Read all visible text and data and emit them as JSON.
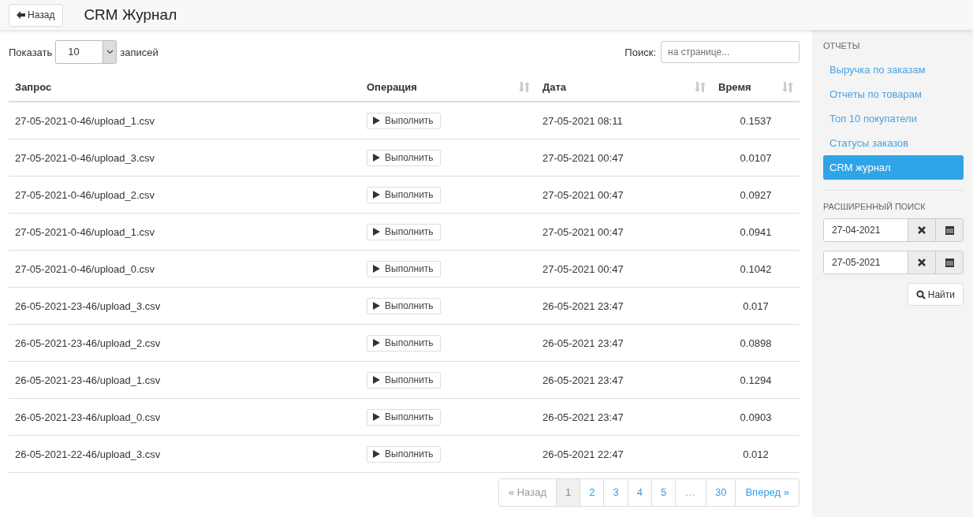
{
  "header": {
    "back_button": "Назад",
    "title": "CRM Журнал"
  },
  "length_control": {
    "before": "Показать",
    "value": "10",
    "after": "записей"
  },
  "search": {
    "label": "Поиск:",
    "placeholder": "на странице..."
  },
  "table": {
    "columns": [
      {
        "label": "Запрос",
        "sortable": false
      },
      {
        "label": "Операция",
        "sortable": true
      },
      {
        "label": "Дата",
        "sortable": true
      },
      {
        "label": "Время",
        "sortable": true
      }
    ],
    "rows": [
      {
        "request": "27-05-2021-0-46/upload_1.csv",
        "action": "Выполнить",
        "date": "27-05-2021 08:11",
        "time": "0.1537"
      },
      {
        "request": "27-05-2021-0-46/upload_3.csv",
        "action": "Выполнить",
        "date": "27-05-2021 00:47",
        "time": "0.0107"
      },
      {
        "request": "27-05-2021-0-46/upload_2.csv",
        "action": "Выполнить",
        "date": "27-05-2021 00:47",
        "time": "0.0927"
      },
      {
        "request": "27-05-2021-0-46/upload_1.csv",
        "action": "Выполнить",
        "date": "27-05-2021 00:47",
        "time": "0.0941"
      },
      {
        "request": "27-05-2021-0-46/upload_0.csv",
        "action": "Выполнить",
        "date": "27-05-2021 00:47",
        "time": "0.1042"
      },
      {
        "request": "26-05-2021-23-46/upload_3.csv",
        "action": "Выполнить",
        "date": "26-05-2021 23:47",
        "time": "0.017"
      },
      {
        "request": "26-05-2021-23-46/upload_2.csv",
        "action": "Выполнить",
        "date": "26-05-2021 23:47",
        "time": "0.0898"
      },
      {
        "request": "26-05-2021-23-46/upload_1.csv",
        "action": "Выполнить",
        "date": "26-05-2021 23:47",
        "time": "0.1294"
      },
      {
        "request": "26-05-2021-23-46/upload_0.csv",
        "action": "Выполнить",
        "date": "26-05-2021 23:47",
        "time": "0.0903"
      },
      {
        "request": "26-05-2021-22-46/upload_3.csv",
        "action": "Выполнить",
        "date": "26-05-2021 22:47",
        "time": "0.012"
      }
    ]
  },
  "pagination": [
    {
      "label": "« Назад",
      "kind": "prev",
      "disabled": true,
      "selected": false
    },
    {
      "label": "1",
      "kind": "page",
      "disabled": false,
      "selected": true
    },
    {
      "label": "2",
      "kind": "page",
      "disabled": false,
      "selected": false
    },
    {
      "label": "3",
      "kind": "page",
      "disabled": false,
      "selected": false
    },
    {
      "label": "4",
      "kind": "page",
      "disabled": false,
      "selected": false
    },
    {
      "label": "5",
      "kind": "page",
      "disabled": false,
      "selected": false
    },
    {
      "label": "...",
      "kind": "ellipsis",
      "disabled": true,
      "selected": false
    },
    {
      "label": "30",
      "kind": "page",
      "disabled": false,
      "selected": false
    },
    {
      "label": "Вперед »",
      "kind": "next",
      "disabled": false,
      "selected": false
    }
  ],
  "sidebar": {
    "reports_heading": "ОТЧЕТЫ",
    "items": [
      {
        "label": "Выручка по заказам",
        "selected": false
      },
      {
        "label": "Отчеты по товарам",
        "selected": false
      },
      {
        "label": "Топ 10 покупатели",
        "selected": false
      },
      {
        "label": "Статусы заказов",
        "selected": false
      },
      {
        "label": "CRM журнал",
        "selected": true
      }
    ],
    "search_heading": "РАСШИРЕННЫЙ ПОИСК",
    "date_from": "27-04-2021",
    "date_to": "27-05-2021",
    "find_button": "Найти"
  }
}
